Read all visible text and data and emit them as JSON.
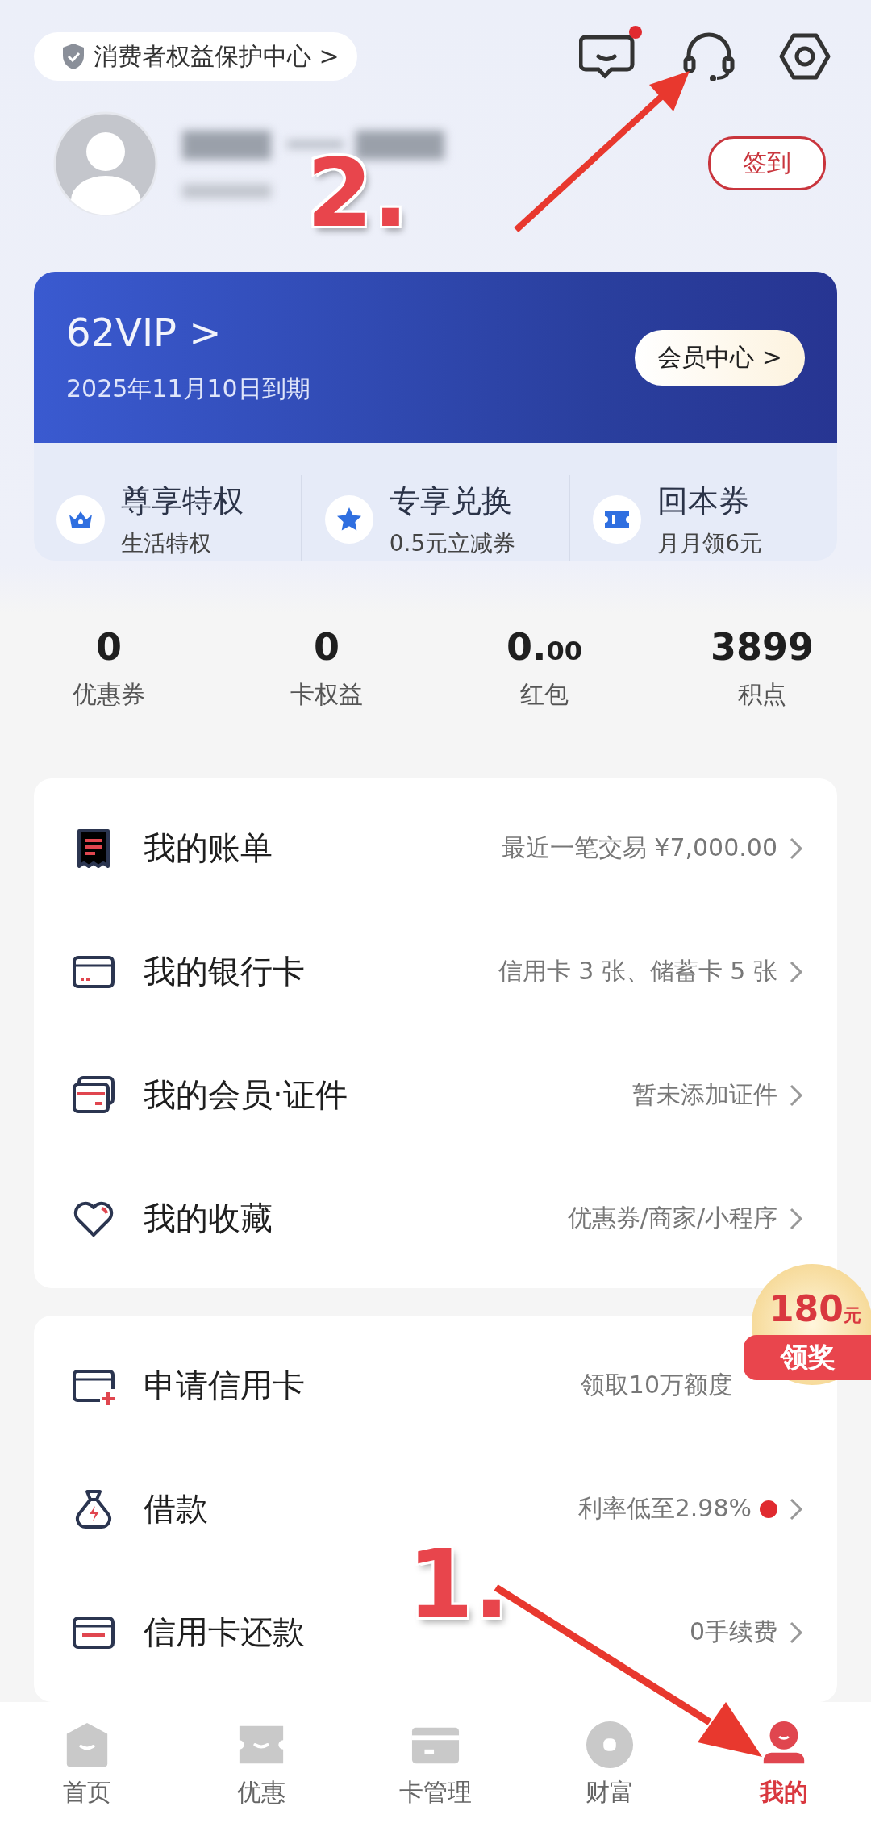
{
  "header": {
    "protection_link": "消费者权益保护中心 >",
    "icons": [
      {
        "kind": "message",
        "dot": true
      },
      {
        "kind": "headset",
        "dot": false
      },
      {
        "kind": "settings",
        "dot": false
      }
    ]
  },
  "profile": {
    "checkin_button": "签到"
  },
  "vip_card": {
    "title": "62VIP >",
    "expiry": "2025年11月10日到期",
    "member_center_button": "会员中心 >",
    "benefits": [
      {
        "kind": "crown",
        "title": "尊享特权",
        "subtitle": "生活特权"
      },
      {
        "kind": "star",
        "title": "专享兑换",
        "subtitle": "0.5元立减券"
      },
      {
        "kind": "ticket",
        "title": "回本券",
        "subtitle": "月月领6元"
      }
    ]
  },
  "stats": [
    {
      "value": "0",
      "label": "优惠券"
    },
    {
      "value": "0",
      "label": "卡权益"
    },
    {
      "value": "0.$_{00}$",
      "label": "红包"
    },
    {
      "value": "3899",
      "label": "积点"
    }
  ],
  "menu_groups": [
    {
      "rows": [
        {
          "kind": "bill",
          "title": "我的账单",
          "detail": "最近一笔交易 ¥7,000.00",
          "dot": false
        },
        {
          "kind": "card",
          "title": "我的银行卡",
          "detail": "信用卡 3 张、储蓄卡 5 张",
          "dot": false
        },
        {
          "kind": "membership",
          "title": "我的会员·证件",
          "detail": "暂未添加证件",
          "dot": false
        },
        {
          "kind": "heart",
          "title": "我的收藏",
          "detail": "优惠券/商家/小程序",
          "dot": false
        }
      ]
    },
    {
      "rows": [
        {
          "kind": "apply",
          "title": "申请信用卡",
          "detail": "领取10万额度",
          "dot": false
        },
        {
          "kind": "loan",
          "title": "借款",
          "detail": "利率低至2.98%",
          "dot": true
        },
        {
          "kind": "repay",
          "title": "信用卡还款",
          "detail": "0手续费",
          "dot": false
        }
      ]
    }
  ],
  "reward_badge": {
    "amount": "180$_{元}$",
    "label": "领奖"
  },
  "bottom_nav": [
    {
      "kind": "home",
      "label": "首页",
      "selected": false
    },
    {
      "kind": "offers",
      "label": "优惠",
      "selected": false
    },
    {
      "kind": "cards",
      "label": "卡管理",
      "selected": false
    },
    {
      "kind": "wealth",
      "label": "财富",
      "selected": false
    },
    {
      "kind": "me",
      "label": "我的",
      "selected": true
    }
  ],
  "annotations": [
    {
      "label": "2."
    },
    {
      "label": "1."
    }
  ]
}
